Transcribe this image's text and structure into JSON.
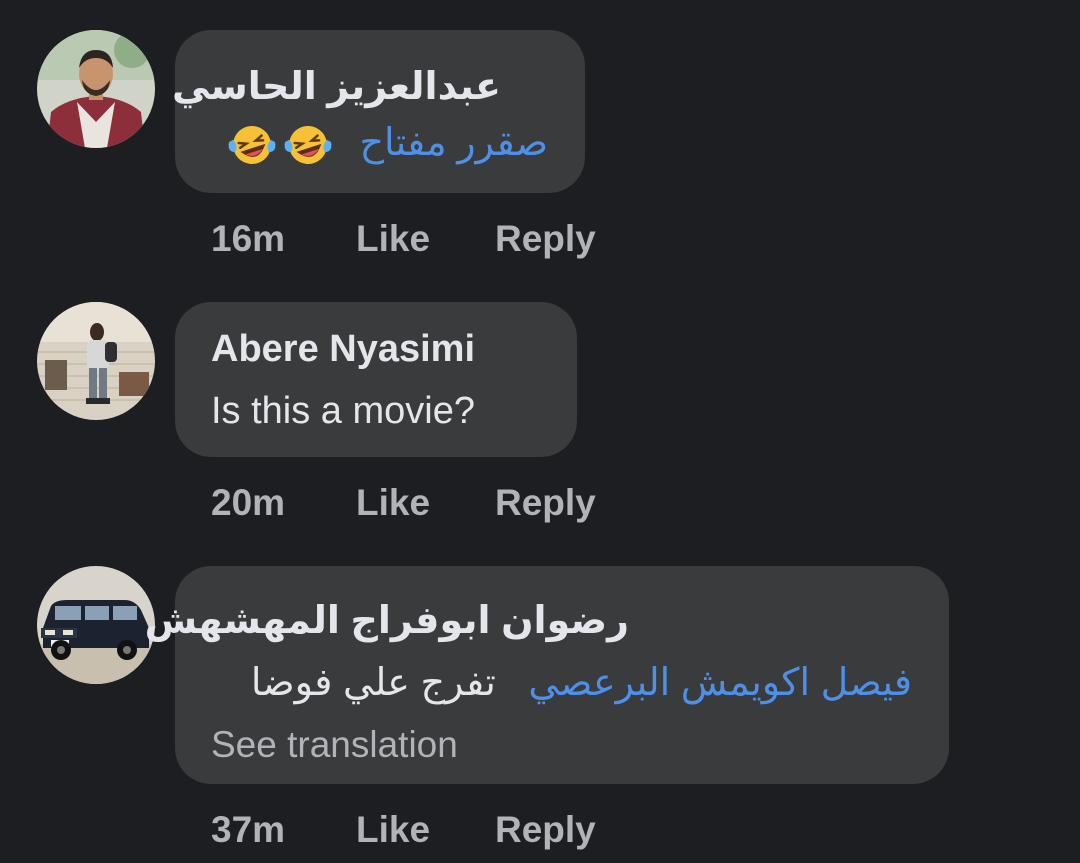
{
  "comments": [
    {
      "author": "عبدالعزيز الحاسي",
      "mention": "صقرر مفتاح",
      "text": "",
      "emojis": [
        "laughing-crying-emoji",
        "laughing-crying-emoji"
      ],
      "time": "16m",
      "like_label": "Like",
      "reply_label": "Reply"
    },
    {
      "author": "Abere Nyasimi",
      "text": "Is this a movie?",
      "time": "20m",
      "like_label": "Like",
      "reply_label": "Reply"
    },
    {
      "author": "رضوان ابوفراج المهشهش",
      "mention": "فيصل اكويمش البرعصي",
      "text": "تفرج علي فوضا",
      "see_translation": "See translation",
      "time": "37m",
      "like_label": "Like",
      "reply_label": "Reply"
    }
  ],
  "colors": {
    "background": "#1d1e21",
    "bubble": "#3a3b3c",
    "mention": "#4e8fe8",
    "secondary_text": "#b0b3b8"
  }
}
